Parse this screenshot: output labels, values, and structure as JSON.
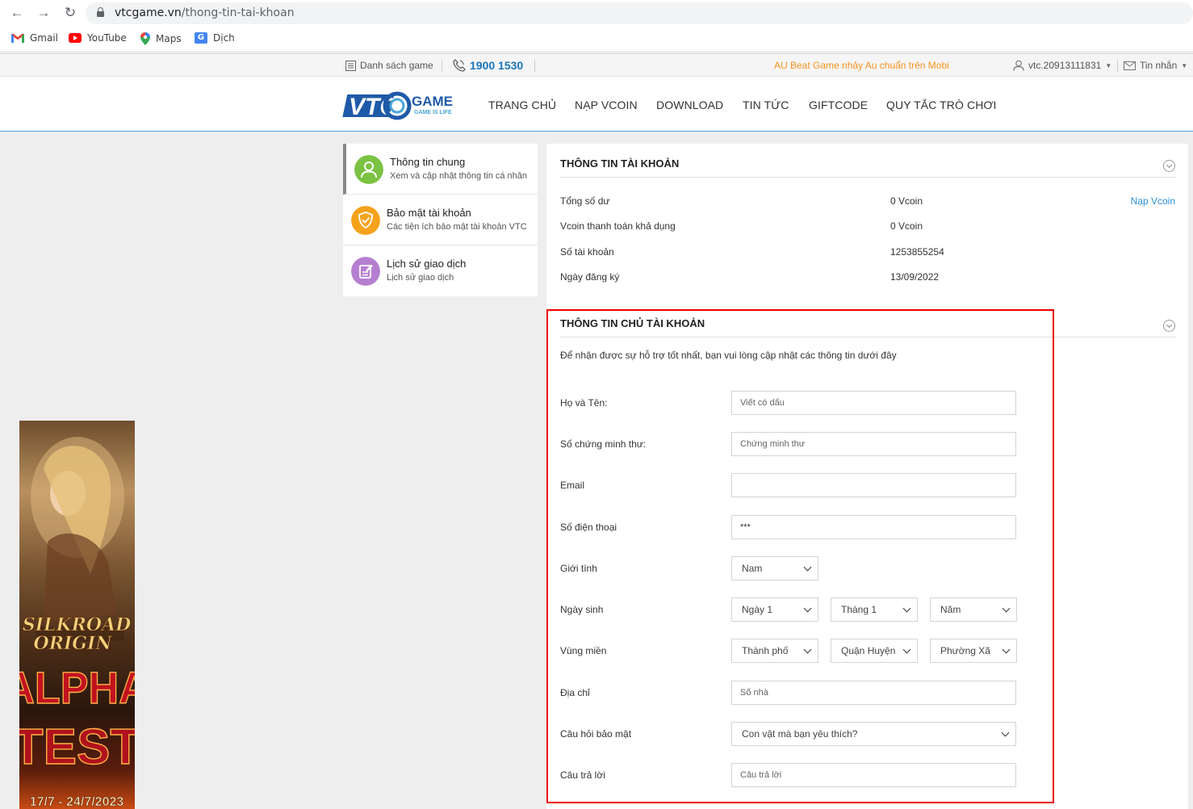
{
  "browser": {
    "url_domain": "vtcgame.vn",
    "url_path": "/thong-tin-tai-khoan",
    "bookmarks": [
      {
        "label": "Gmail",
        "icon": "gmail-icon"
      },
      {
        "label": "YouTube",
        "icon": "youtube-icon"
      },
      {
        "label": "Maps",
        "icon": "maps-icon"
      },
      {
        "label": "Dịch",
        "icon": "translate-icon"
      }
    ]
  },
  "topbar": {
    "game_list": "Danh sách game",
    "hotline": "1900 1530",
    "promo": "AU Beat Game nhảy Au chuẩn trên Mobi",
    "username": "vtc.20913111831",
    "messages": "Tin nhắn"
  },
  "header": {
    "logo_main": "VTC",
    "logo_game": "GAME",
    "logo_tagline": "GAME IS LIFE",
    "nav": [
      "TRANG CHỦ",
      "NẠP VCOIN",
      "DOWNLOAD",
      "TIN TỨC",
      "GIFTCODE",
      "QUY TẮC TRÒ CHƠI"
    ]
  },
  "sidebar": {
    "items": [
      {
        "title": "Thông tin chung",
        "subtitle": "Xem và cập nhật thông tin cá nhân",
        "icon": "user-icon",
        "color": "#7cc242"
      },
      {
        "title": "Bảo mật tài khoản",
        "subtitle": "Các tiện ích bảo mật tài khoản VTC",
        "icon": "shield-icon",
        "color": "#f7a21b"
      },
      {
        "title": "Lịch sử giao dịch",
        "subtitle": "Lịch sử giao dịch",
        "icon": "edit-icon",
        "color": "#b57fd1"
      }
    ]
  },
  "ad": {
    "line1": "SILKROAD",
    "line2": "ORIGIN",
    "line3": "ALPHA",
    "line4": "TEST",
    "dates": "17/7 - 24/7/2023"
  },
  "account": {
    "title": "THÔNG TIN TÀI KHOẢN",
    "rows": [
      {
        "label": "Tổng số dư",
        "value": "0 Vcoin",
        "link": "Nạp Vcoin"
      },
      {
        "label": "Vcoin thanh toán khả dụng",
        "value": "0 Vcoin"
      },
      {
        "label": "Số tài khoản",
        "value": "1253855254"
      },
      {
        "label": "Ngày đăng ký",
        "value": "13/09/2022"
      }
    ]
  },
  "owner": {
    "title": "THÔNG TIN CHỦ TÀI KHOẢN",
    "description": "Để nhận được sự hỗ trợ tốt nhất, bạn vui lòng cập nhật các thông tin dưới đây",
    "fullname": {
      "label": "Họ và Tên:",
      "placeholder": "Viết có dấu"
    },
    "id_card": {
      "label": "Số chứng minh thư:",
      "placeholder": "Chứng minh thư"
    },
    "email": {
      "label": "Email",
      "placeholder": ""
    },
    "phone": {
      "label": "Số điện thoại",
      "value": "***"
    },
    "gender": {
      "label": "Giới tính",
      "value": "Nam"
    },
    "birthday": {
      "label": "Ngày sinh",
      "day": "Ngày 1",
      "month": "Tháng 1",
      "year": "Năm"
    },
    "region": {
      "label": "Vùng miền",
      "city": "Thành phố",
      "district": "Quận Huyện",
      "ward": "Phường Xã"
    },
    "address": {
      "label": "Địa chỉ",
      "placeholder": "Số nhà"
    },
    "security_question": {
      "label": "Câu hỏi bảo mật",
      "value": "Con vật mà bạn yêu thích?"
    },
    "answer": {
      "label": "Câu trả lời",
      "placeholder": "Câu trả lời"
    }
  },
  "colors": {
    "accent_blue": "#1a75bb",
    "link_blue": "#2b8fd6",
    "promo_orange": "#f7931e",
    "highlight_red": "#e00000"
  }
}
